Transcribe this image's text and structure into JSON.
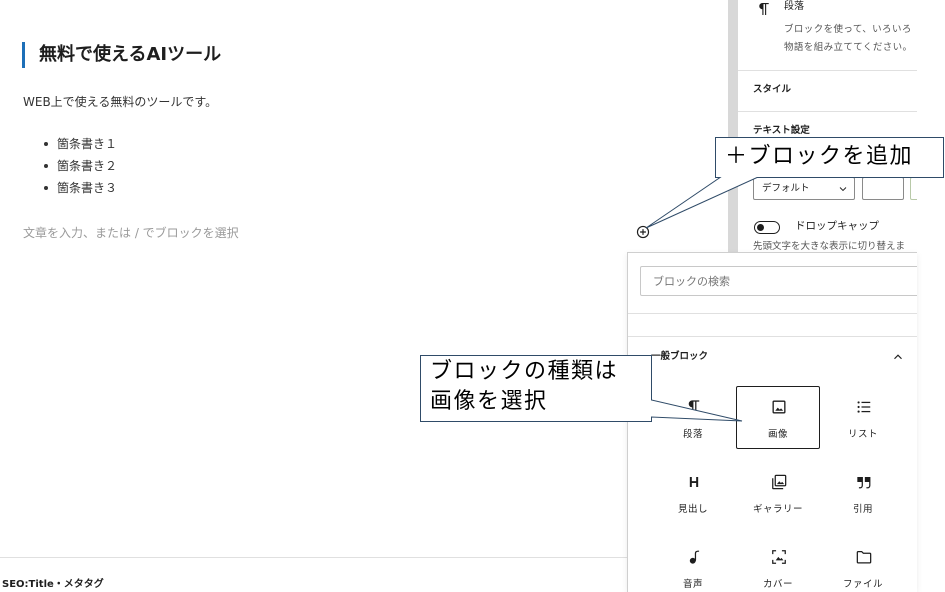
{
  "editor": {
    "heading": "無料で使えるAIツール",
    "paragraph": "WEB上で使える無料のツールです。",
    "list_items": [
      "箇条書き１",
      "箇条書き２",
      "箇条書き３"
    ],
    "placeholder": "文章を入力、または / でブロックを選択",
    "inserter_button_icon": "plus-circle-icon"
  },
  "footer": {
    "seo_label": "SEO:Title・メタタグ"
  },
  "sidebar": {
    "block_card": {
      "icon": "paragraph-icon",
      "title": "段落",
      "description": [
        "ブロックを使って、いろいろ",
        "物語を組み立ててください。"
      ]
    },
    "style_panel_title": "スタイル",
    "text_settings": {
      "title": "テキスト設定",
      "font_size_selected": "デフォルト",
      "drop_cap": {
        "label": "ドロップキャップ",
        "enabled": false,
        "help": "先頭文字を大きな表示に切り替えま"
      }
    }
  },
  "inserter": {
    "search_placeholder": "ブロックの検索",
    "category": {
      "title": "一般ブロック",
      "expanded": true
    },
    "blocks": [
      {
        "label": "段落",
        "icon": "paragraph-icon"
      },
      {
        "label": "画像",
        "icon": "image-icon",
        "selected": true
      },
      {
        "label": "リスト",
        "icon": "list-icon"
      },
      {
        "label": "見出し",
        "icon": "heading-icon"
      },
      {
        "label": "ギャラリー",
        "icon": "gallery-icon"
      },
      {
        "label": "引用",
        "icon": "quote-icon"
      },
      {
        "label": "音声",
        "icon": "audio-icon"
      },
      {
        "label": "カバー",
        "icon": "cover-icon"
      },
      {
        "label": "ファイル",
        "icon": "folder-icon"
      }
    ]
  },
  "callouts": {
    "add_block": "＋ブロックを追加",
    "block_type": [
      "ブロックの種類は",
      "画像を選択"
    ]
  },
  "colors": {
    "heading_accent": "#1d6fb8",
    "callout_border": "#2f4b68",
    "text": "#1e1e1e",
    "placeholder": "#9a9a9a"
  }
}
